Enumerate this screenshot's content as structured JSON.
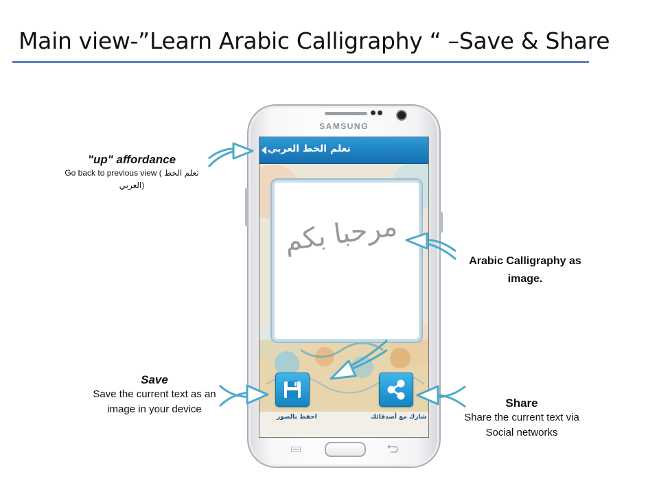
{
  "slide": {
    "title": "Main view-”Learn Arabic Calligraphy “ –Save & Share"
  },
  "phone": {
    "brand": "SAMSUNG"
  },
  "app": {
    "title": "تعلم الخط العربي",
    "calligraphy_text": "مرحبا بكم",
    "save_label": "احفظ بالصور",
    "share_label": "شارك مع أصدقائك",
    "icons": {
      "up": "back-caret-icon",
      "save": "floppy-disk-icon",
      "share": "share-icon"
    },
    "colors": {
      "action_bar": "#1e86c8",
      "button": "#2a9fd8",
      "arrow": "#4da9c9"
    }
  },
  "callouts": {
    "up": {
      "heading": "\"up\" affordance",
      "text": "Go back to previous view ( تعلم الخط العربي)"
    },
    "calligraphy": {
      "heading": "Arabic Calligraphy as image."
    },
    "save": {
      "heading": "Save",
      "text": "Save the current text as an image in your device"
    },
    "share": {
      "heading": "Share",
      "text": "Share the current text via Social networks"
    }
  }
}
